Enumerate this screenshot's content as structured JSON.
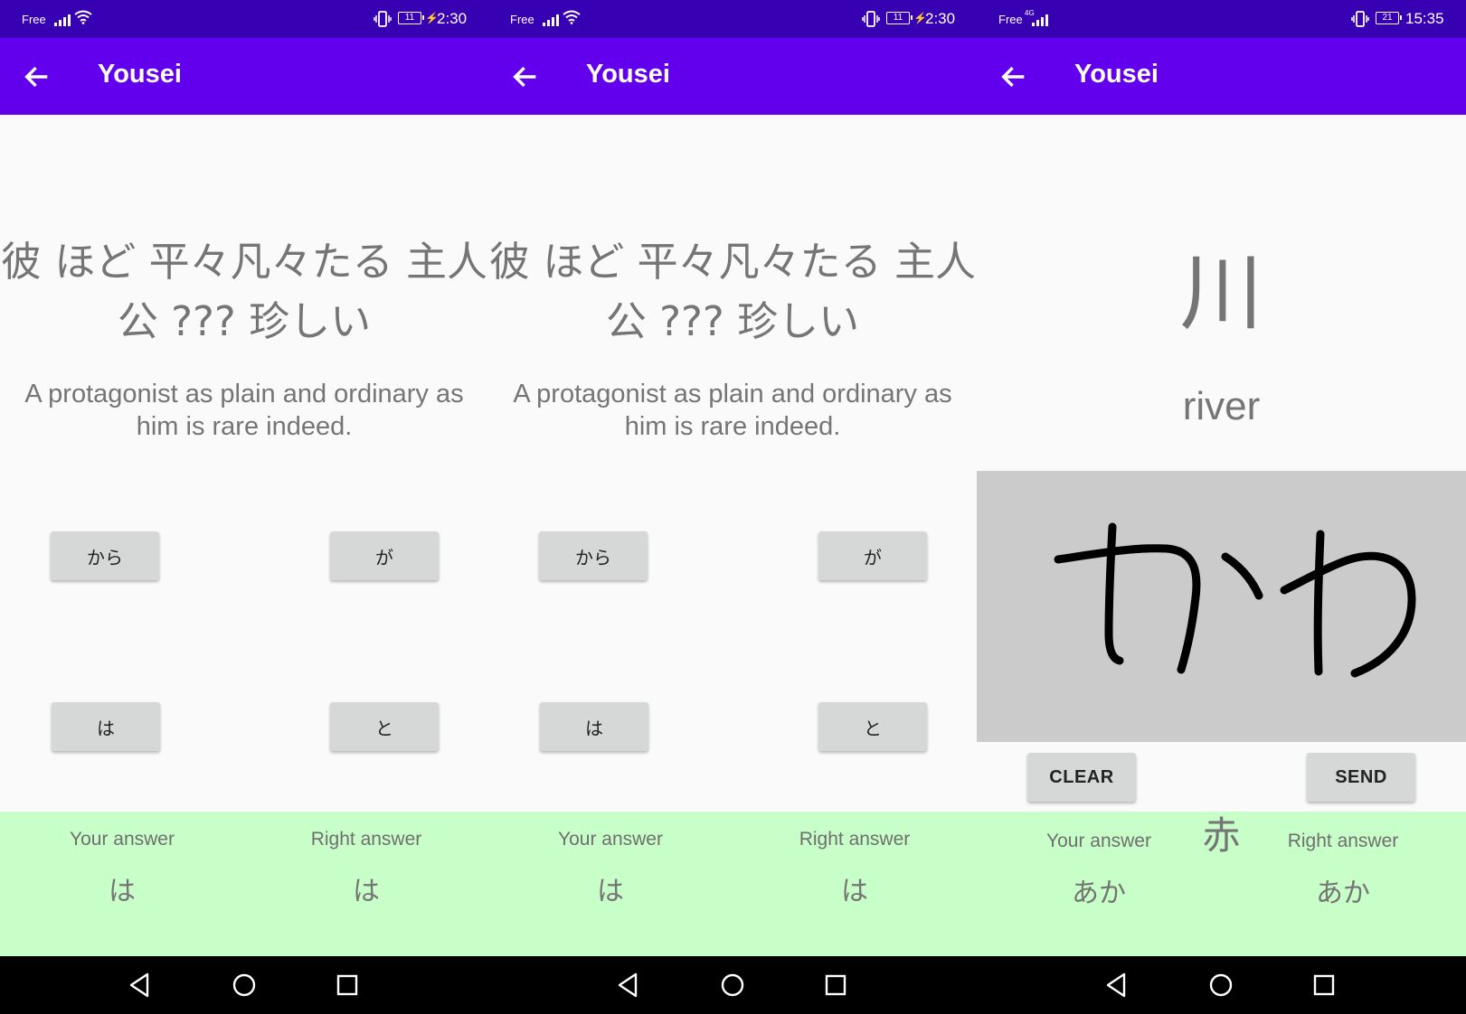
{
  "screens": [
    {
      "status": {
        "carrier": "Free",
        "battery": "11",
        "time": "2:30"
      },
      "app_title": "Yousei",
      "sentence_jp": "彼 ほど 平々凡々たる 主人公 ??? 珍しい",
      "sentence_en": "A protagonist as plain and ordinary as him is rare indeed.",
      "choices": [
        "から",
        "が",
        "は",
        "と"
      ],
      "your_answer_label": "Your answer",
      "your_answer": "は",
      "right_answer_label": "Right answer",
      "right_answer": "は"
    },
    {
      "status": {
        "carrier": "Free",
        "battery": "11",
        "time": "2:30"
      },
      "app_title": "Yousei",
      "sentence_jp": "彼 ほど 平々凡々たる 主人公 ??? 珍しい",
      "sentence_en": "A protagonist as plain and ordinary as him is rare indeed.",
      "choices": [
        "から",
        "が",
        "は",
        "と"
      ],
      "your_answer_label": "Your answer",
      "your_answer": "は",
      "right_answer_label": "Right answer",
      "right_answer": "は"
    },
    {
      "status": {
        "carrier": "Free",
        "network": "4G",
        "battery": "21",
        "time": "15:35"
      },
      "app_title": "Yousei",
      "kanji": "川",
      "meaning": "river",
      "drawn_text": "かわ",
      "clear_label": "CLEAR",
      "send_label": "SEND",
      "your_answer_label": "Your answer",
      "your_answer": "あか",
      "previous_kanji": "赤",
      "right_answer_label": "Right answer",
      "right_answer": "あか"
    }
  ],
  "colors": {
    "status_bar": "#3700b3",
    "app_bar": "#6200ee",
    "answer_background": "#c8ffc8",
    "canvas_background": "#cbcbcb",
    "button": "#d6d7d7"
  },
  "icons": [
    "back-arrow-icon",
    "signal-icon",
    "wifi-icon",
    "vibrate-icon",
    "battery-icon",
    "charging-icon",
    "nav-back-icon",
    "nav-home-icon",
    "nav-recents-icon"
  ]
}
